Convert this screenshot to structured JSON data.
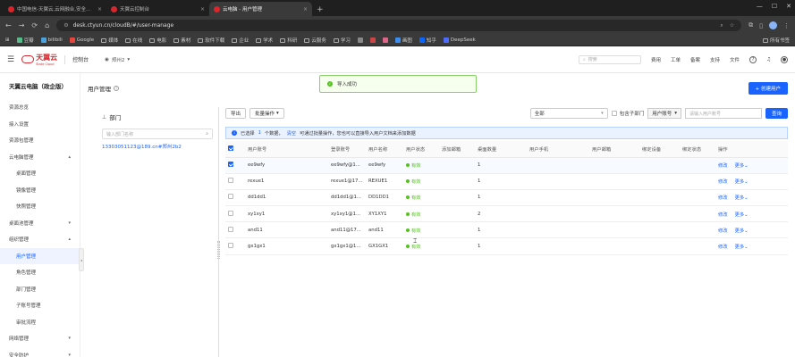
{
  "browser": {
    "tabs": [
      {
        "label": "中国电信-天翼云,云网融合,安全..."
      },
      {
        "label": "天翼云控制台"
      },
      {
        "label": "云电脑 - 用户管理"
      }
    ],
    "address": "desk.ctyun.cn/cloudB/#/user-manage",
    "bookmarks": [
      "豆瓣",
      "bilibili",
      "Google",
      "媒体",
      "在线",
      "电影",
      "素材",
      "软件下载",
      "企业",
      "学术",
      "科研",
      "云服务",
      "学习",
      "",
      "",
      "",
      "画图",
      "知乎",
      "DeepSeek",
      "",
      "所有书签"
    ]
  },
  "app": {
    "logo_text": "天翼云",
    "logo_sub": "State Cloud",
    "console": "控制台",
    "region": "郑州2",
    "search_placeholder": "搜索",
    "header_links": [
      "费用",
      "工单",
      "备案",
      "支持",
      "文件"
    ]
  },
  "sidebar": {
    "product_title": "天翼云电脑（政企版）",
    "items": [
      {
        "label": "资源总览",
        "caret": "",
        "sub": false,
        "active": false
      },
      {
        "label": "接入设置",
        "caret": "",
        "sub": false,
        "active": false
      },
      {
        "label": "资源包管理",
        "caret": "",
        "sub": false,
        "active": false
      },
      {
        "label": "云电脑管理",
        "caret": "▴",
        "sub": false,
        "active": false
      },
      {
        "label": "桌面管理",
        "caret": "",
        "sub": true,
        "active": false
      },
      {
        "label": "镜像管理",
        "caret": "",
        "sub": true,
        "active": false
      },
      {
        "label": "快照管理",
        "caret": "",
        "sub": true,
        "active": false
      },
      {
        "label": "桌面池管理",
        "caret": "▾",
        "sub": false,
        "active": false
      },
      {
        "label": "组织管理",
        "caret": "▴",
        "sub": false,
        "active": false
      },
      {
        "label": "用户管理",
        "caret": "",
        "sub": true,
        "active": true
      },
      {
        "label": "角色管理",
        "caret": "",
        "sub": true,
        "active": false
      },
      {
        "label": "部门管理",
        "caret": "",
        "sub": true,
        "active": false
      },
      {
        "label": "子账号管理",
        "caret": "",
        "sub": true,
        "active": false
      },
      {
        "label": "审批流程",
        "caret": "",
        "sub": true,
        "active": false
      },
      {
        "label": "网络管理",
        "caret": "▾",
        "sub": false,
        "active": false
      },
      {
        "label": "安全防护",
        "caret": "▾",
        "sub": false,
        "active": false
      }
    ]
  },
  "page": {
    "title": "用户管理",
    "create_button": "+ 创建用户",
    "toast": "导入成功"
  },
  "dept": {
    "title": "部门",
    "search_placeholder": "输入部门名称",
    "node": "13303051123@189.cn#郑州2b2"
  },
  "toolbar": {
    "export": "导出",
    "batch": "批量操作",
    "filter_value": "全部",
    "include_sub": "包含子部门",
    "search_type": "用户账号",
    "search_placeholder": "请输入用户账号",
    "search_btn": "查询"
  },
  "selection": {
    "prefix": "已选择",
    "count": "1",
    "unit": "个数据，",
    "clear": "清空",
    "note": "可通过批量操作，您也可以直接导入用户文档来添加数据"
  },
  "table": {
    "headers": [
      "用户账号",
      "登录账号",
      "用户名称",
      "用户状态",
      "添加邮箱",
      "桌面数量",
      "用户手机",
      "用户邮箱",
      "绑定设备",
      "绑定状态",
      "操作"
    ],
    "rows": [
      {
        "account": "ee9wfy",
        "login": "ee9wfy@1...",
        "name": "ee9wfy",
        "status": "有效",
        "desktops": "1",
        "checked": true
      },
      {
        "account": "rexue1",
        "login": "rexue1@17...",
        "name": "REXUE1",
        "status": "有效",
        "desktops": "1",
        "checked": false
      },
      {
        "account": "dd1dd1",
        "login": "dd1dd1@1...",
        "name": "DD1DD1",
        "status": "有效",
        "desktops": "1",
        "checked": false
      },
      {
        "account": "xy1xy1",
        "login": "xy1xy1@1...",
        "name": "XY1XY1",
        "status": "有效",
        "desktops": "2",
        "checked": false
      },
      {
        "account": "and11",
        "login": "and11@17...",
        "name": "and11",
        "status": "有效",
        "desktops": "1",
        "checked": false
      },
      {
        "account": "gx1gx1",
        "login": "gx1gx1@1...",
        "name": "GX1GX1",
        "status": "有效",
        "desktops": "1",
        "checked": false
      }
    ],
    "action_edit": "修改",
    "action_more": "更多"
  }
}
